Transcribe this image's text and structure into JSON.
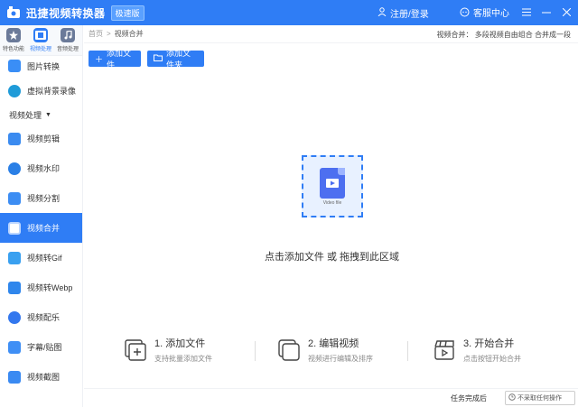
{
  "titlebar": {
    "app_title": "迅捷视频转换器",
    "badge": "极速版",
    "login": "注册/登录",
    "service": "客服中心"
  },
  "sidebar": {
    "cat_tabs": [
      {
        "label": "特色功能",
        "icon": "star-icon",
        "active": false
      },
      {
        "label": "视频处理",
        "icon": "film-icon",
        "active": true
      },
      {
        "label": "音频处理",
        "icon": "audio-icon",
        "active": false
      }
    ],
    "top_items": [
      {
        "label": "图片转换",
        "icon": "image-convert-icon"
      },
      {
        "label": "虚拟背景录像",
        "icon": "virtual-bg-icon"
      }
    ],
    "section_label": "视频处理",
    "items": [
      {
        "label": "视频剪辑",
        "icon": "video-edit-icon",
        "active": false
      },
      {
        "label": "视频水印",
        "icon": "watermark-icon",
        "active": false
      },
      {
        "label": "视频分割",
        "icon": "split-icon",
        "active": false
      },
      {
        "label": "视频合并",
        "icon": "merge-icon",
        "active": true
      },
      {
        "label": "视频转Gif",
        "icon": "gif-icon",
        "active": false
      },
      {
        "label": "视频转Webp",
        "icon": "webp-icon",
        "active": false
      },
      {
        "label": "视频配乐",
        "icon": "music-icon",
        "active": false
      },
      {
        "label": "字幕/贴图",
        "icon": "subtitle-icon",
        "active": false
      },
      {
        "label": "视频截图",
        "icon": "screenshot-icon",
        "active": false
      }
    ]
  },
  "breadcrumb": {
    "home": "首页",
    "sep": ">",
    "current": "视频合并"
  },
  "hint": "视频合并： 多段视频自由组合 合并成一段",
  "buttons": {
    "add_file": "添加文件",
    "add_folder": "添加文件夹"
  },
  "dropzone": {
    "file_label": "Video file",
    "text": "点击添加文件 或 拖拽到此区域"
  },
  "steps": [
    {
      "title": "1. 添加文件",
      "sub": "支持批量添加文件"
    },
    {
      "title": "2. 编辑视频",
      "sub": "视频进行编辑及排序"
    },
    {
      "title": "3. 开始合并",
      "sub": "点击按钮开始合并"
    }
  ],
  "status": {
    "label": "任务完成后",
    "select_value": "不采取任何操作"
  },
  "colors": {
    "brand": "#2f7df5",
    "dropzone_bg": "#e8f1ff"
  }
}
